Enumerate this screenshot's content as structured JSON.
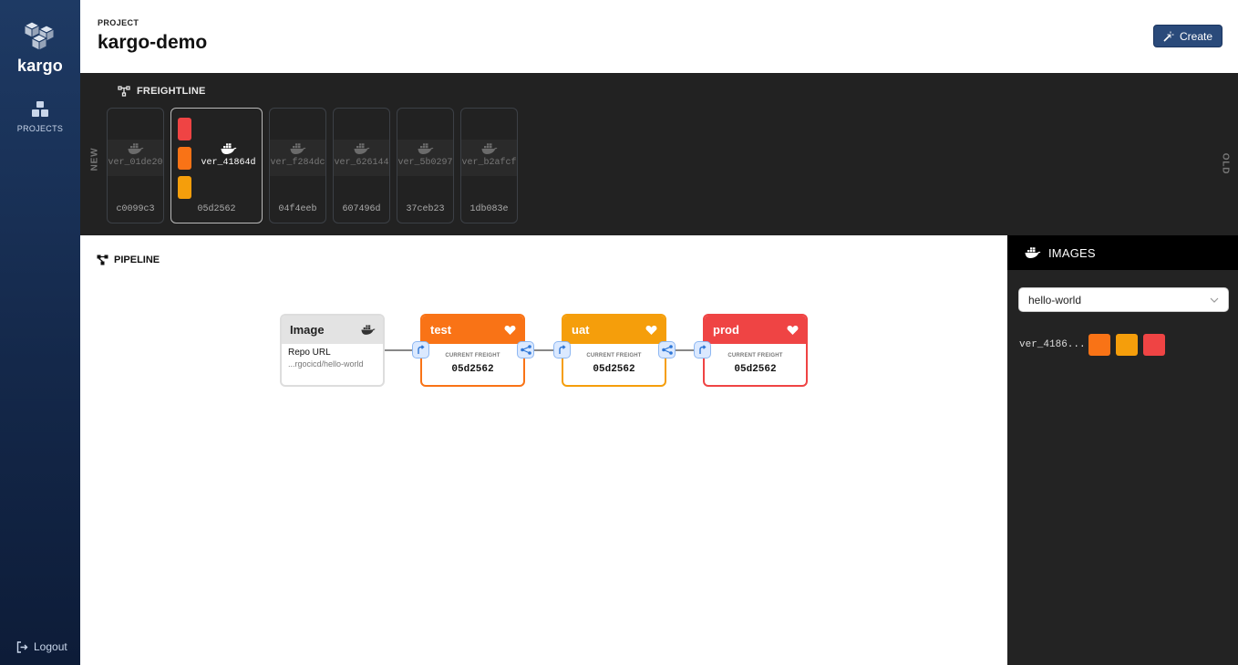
{
  "sidebar": {
    "logo_text": "kargo",
    "nav_projects": "PROJECTS",
    "logout": "Logout"
  },
  "header": {
    "project_label": "PROJECT",
    "project_name": "kargo-demo",
    "create_label": "Create"
  },
  "freightline": {
    "title": "FREIGHTLINE",
    "new_label": "NEW",
    "old_label": "OLD",
    "items": [
      {
        "tag": "ver_01de20",
        "sha": "c0099c3"
      },
      {
        "tag": "ver_41864d",
        "sha": "05d2562"
      },
      {
        "tag": "ver_f284dc",
        "sha": "04f4eeb"
      },
      {
        "tag": "ver_626144",
        "sha": "607496d"
      },
      {
        "tag": "ver_5b0297",
        "sha": "37ceb23"
      },
      {
        "tag": "ver_b2afcf",
        "sha": "1db083e"
      }
    ]
  },
  "pipeline": {
    "title": "PIPELINE",
    "image_node": {
      "title": "Image",
      "repo_label": "Repo URL",
      "repo_url": "...rgocicd/hello-world"
    },
    "stages": [
      {
        "name": "test",
        "current_freight_label": "CURRENT FREIGHT",
        "current_freight": "05d2562",
        "color": "#f97316"
      },
      {
        "name": "uat",
        "current_freight_label": "CURRENT FREIGHT",
        "current_freight": "05d2562",
        "color": "#f59e0b"
      },
      {
        "name": "prod",
        "current_freight_label": "CURRENT FREIGHT",
        "current_freight": "05d2562",
        "color": "#ef4444"
      }
    ]
  },
  "images_panel": {
    "title": "IMAGES",
    "selected_image": "hello-world",
    "rows": [
      {
        "tag": "ver_4186..."
      }
    ]
  },
  "colors": {
    "test": "#f97316",
    "uat": "#f59e0b",
    "prod": "#ef4444",
    "sidebar": "#1e3a64"
  }
}
